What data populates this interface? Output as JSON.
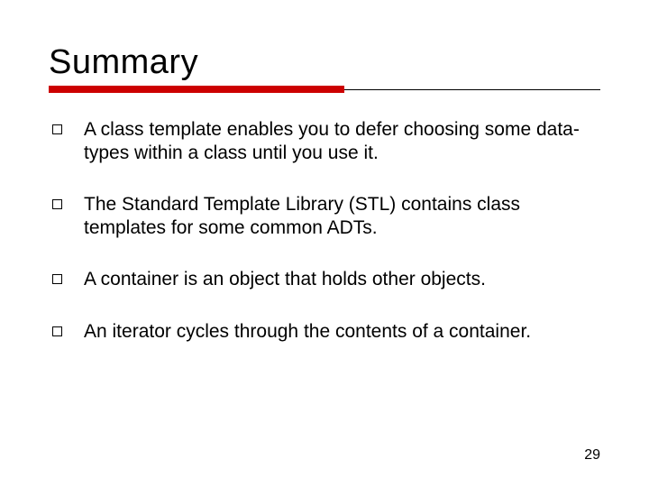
{
  "slide": {
    "title": "Summary",
    "bullets": [
      "A class template enables you to defer choosing some data-types within a class until you use it.",
      "The Standard Template Library (STL) contains class templates for some common ADTs.",
      "A container is an object that holds other objects.",
      "An iterator cycles through the contents of a container."
    ],
    "page_number": "29"
  }
}
